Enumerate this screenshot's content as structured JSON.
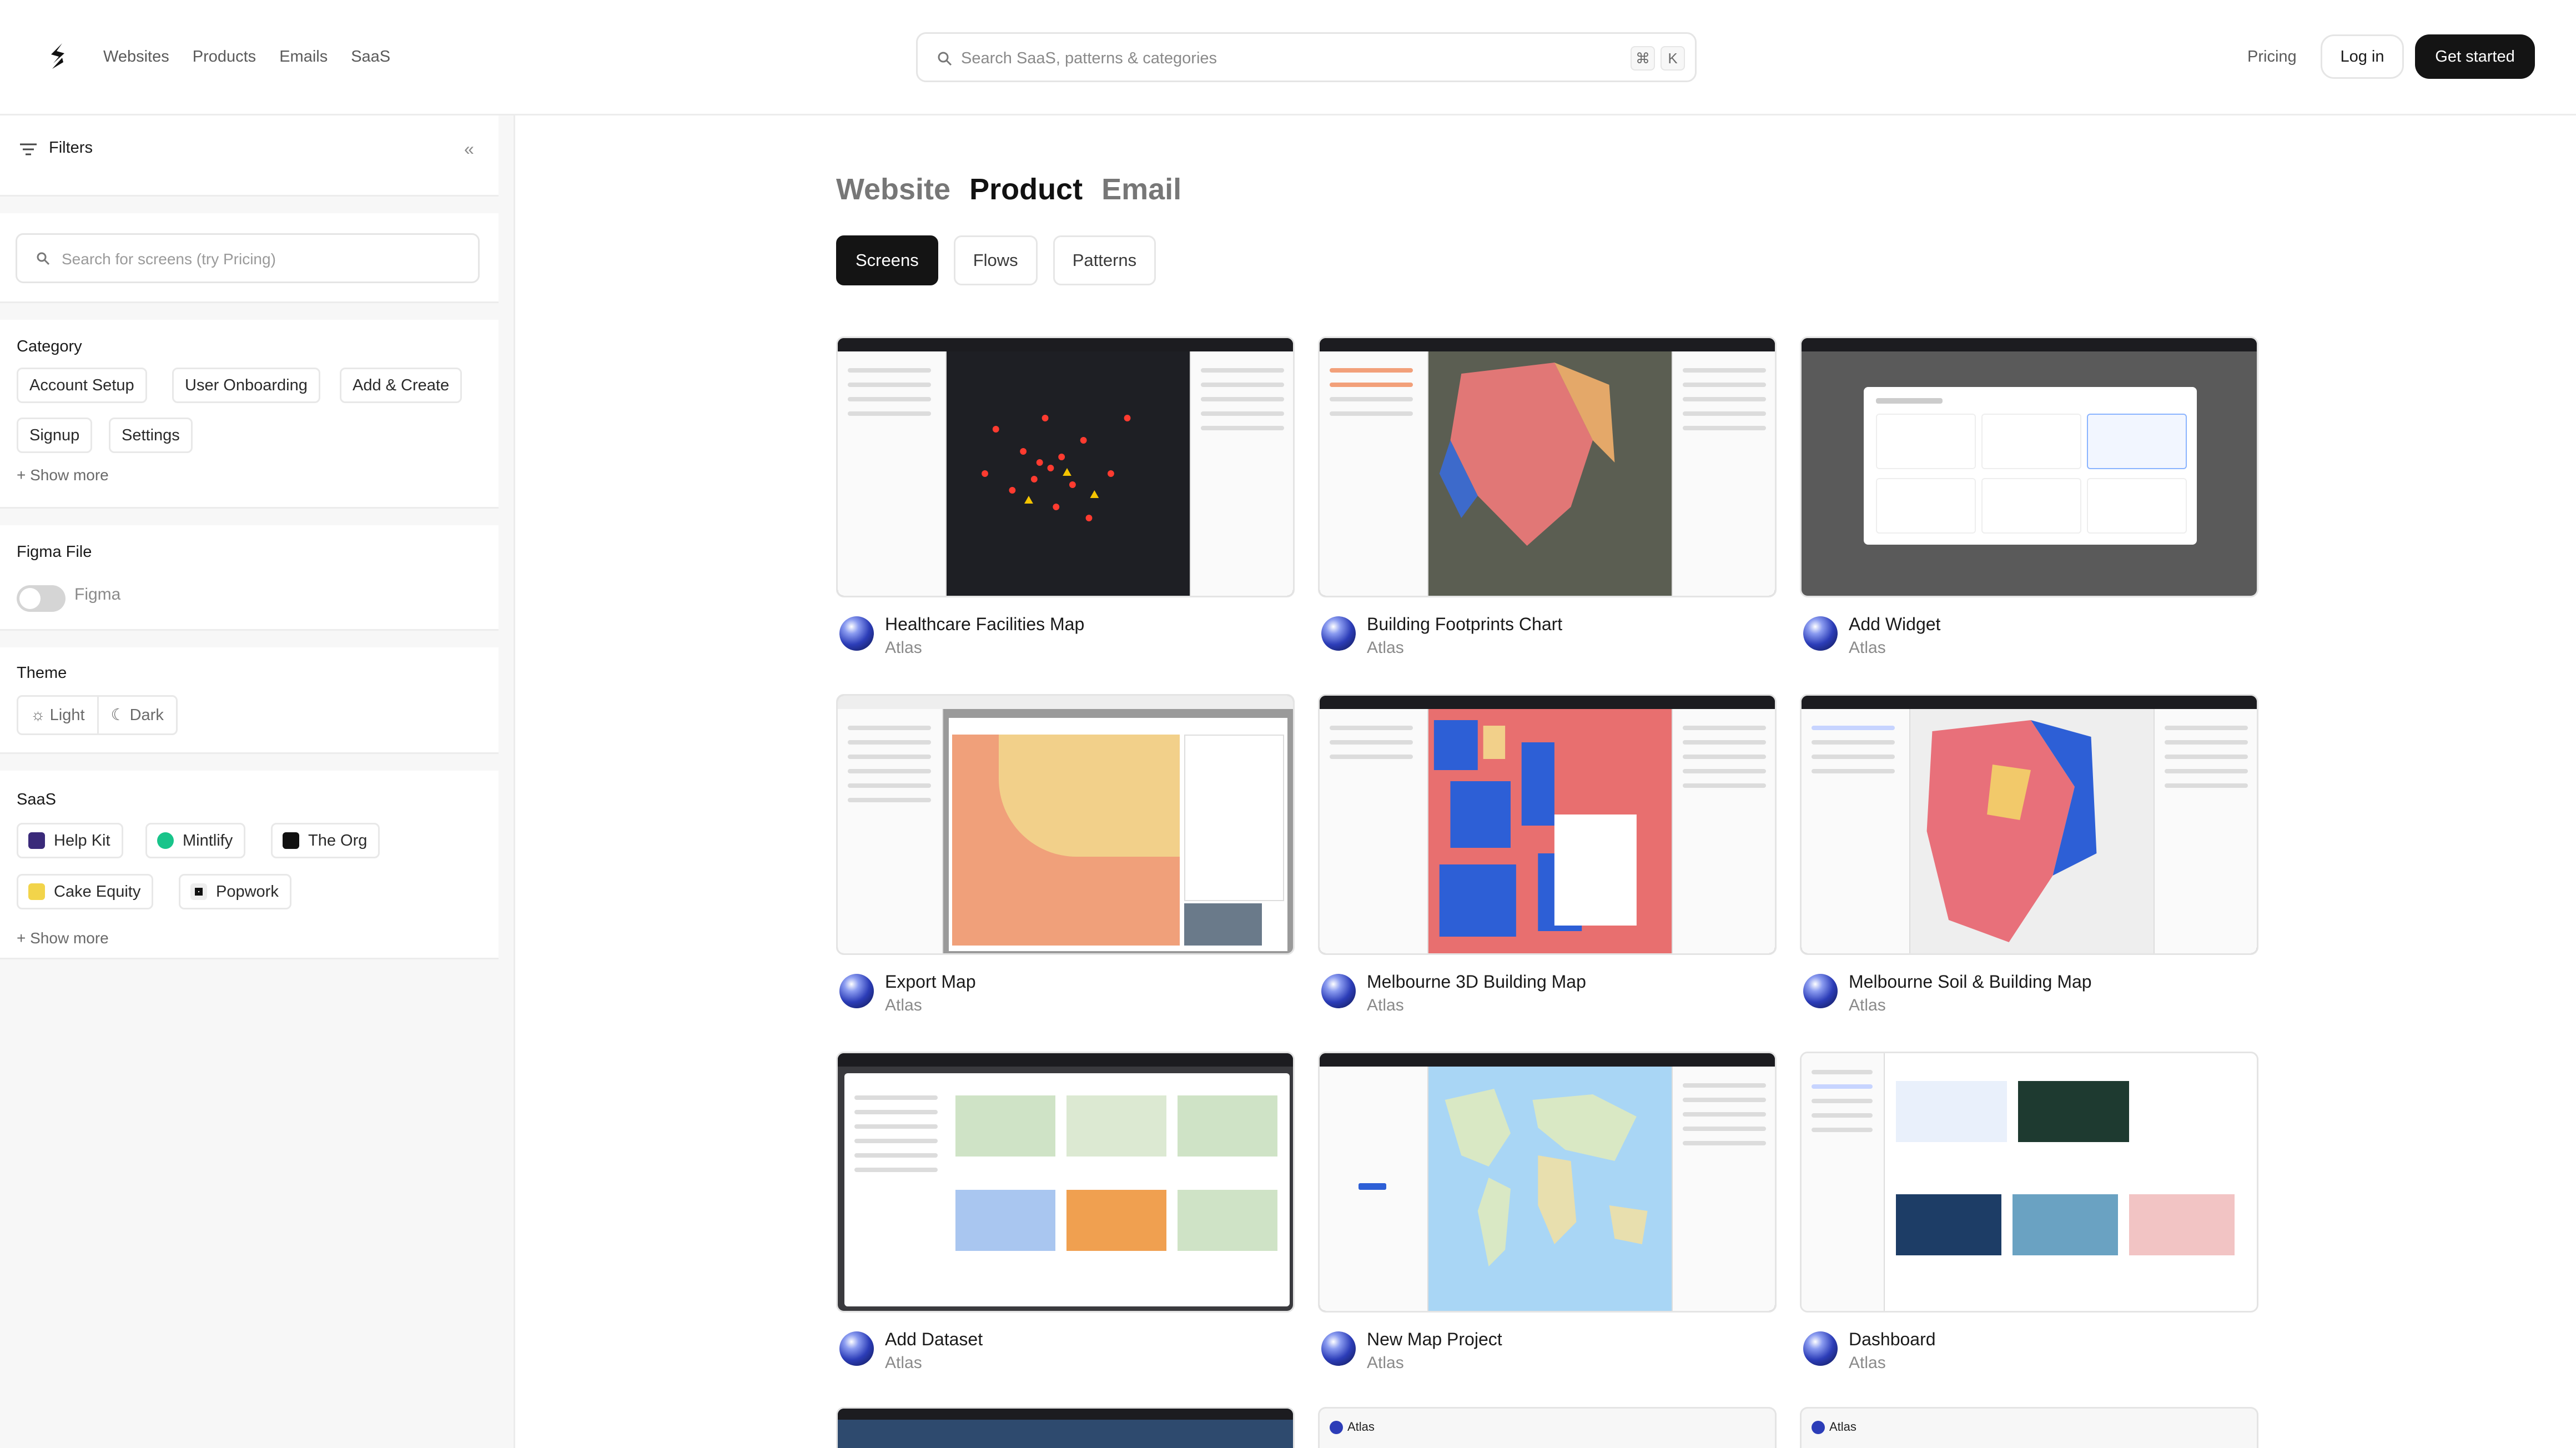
{
  "header": {
    "nav": [
      "Websites",
      "Products",
      "Emails",
      "SaaS"
    ],
    "search_placeholder": "Search SaaS, patterns & categories",
    "kbd1": "⌘",
    "kbd2": "K",
    "pricing": "Pricing",
    "login": "Log in",
    "get_started": "Get started"
  },
  "sidebar": {
    "filters_label": "Filters",
    "collapse_glyph": "«",
    "search_placeholder": "Search for screens (try Pricing)",
    "category": {
      "title": "Category",
      "chips": [
        "Account Setup",
        "User Onboarding",
        "Add & Create",
        "Signup",
        "Settings"
      ],
      "show_more": "+ Show more"
    },
    "figma": {
      "title": "Figma File",
      "toggle_label": "Figma"
    },
    "theme": {
      "title": "Theme",
      "light": "Light",
      "dark": "Dark"
    },
    "saas": {
      "title": "SaaS",
      "chips": [
        "Help Kit",
        "Mintlify",
        "The Org",
        "Cake Equity",
        "Popwork"
      ],
      "show_more": "+ Show more"
    }
  },
  "main": {
    "tabs": [
      "Website",
      "Product",
      "Email"
    ],
    "active_tab": "Product",
    "subtabs": [
      "Screens",
      "Flows",
      "Patterns"
    ],
    "active_subtab": "Screens",
    "cards": [
      {
        "title": "Healthcare Facilities Map",
        "app": "Atlas"
      },
      {
        "title": "Building Footprints Chart",
        "app": "Atlas"
      },
      {
        "title": "Add Widget",
        "app": "Atlas"
      },
      {
        "title": "Export Map",
        "app": "Atlas"
      },
      {
        "title": "Melbourne 3D Building Map",
        "app": "Atlas"
      },
      {
        "title": "Melbourne Soil & Building Map",
        "app": "Atlas"
      },
      {
        "title": "Add Dataset",
        "app": "Atlas"
      },
      {
        "title": "New Map Project",
        "app": "Atlas"
      },
      {
        "title": "Dashboard",
        "app": "Atlas"
      }
    ],
    "partial_labels": [
      "Atlas",
      "Atlas"
    ]
  },
  "colors": {
    "accent_dark": "#141414",
    "atlas_blue": "#2c3db8"
  }
}
